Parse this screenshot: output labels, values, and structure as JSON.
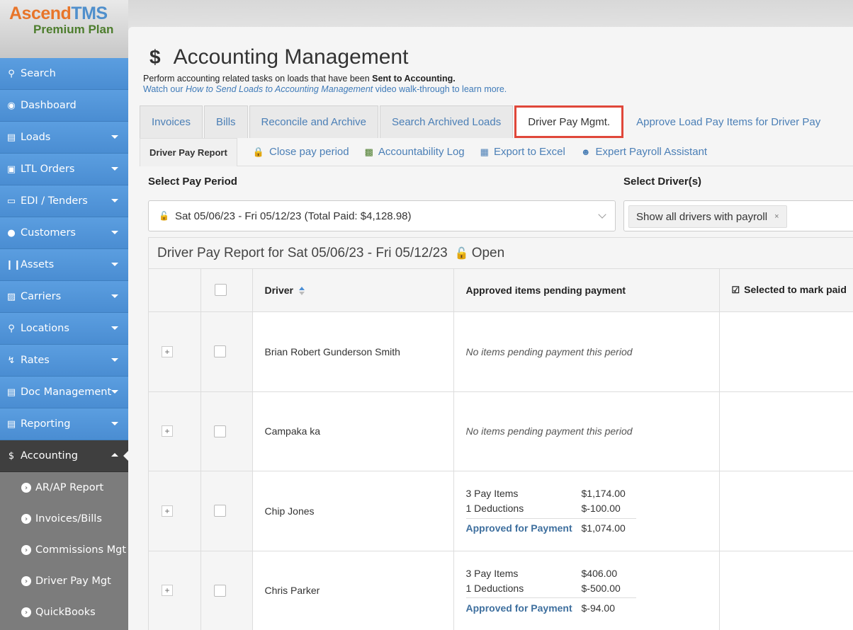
{
  "app": {
    "brand_part1": "Ascend",
    "brand_part2": "TMS",
    "plan": "Premium Plan"
  },
  "sidebar": {
    "items": [
      {
        "label": "Search",
        "icon": "search-icon",
        "caret": false
      },
      {
        "label": "Dashboard",
        "icon": "dashboard-icon",
        "caret": false
      },
      {
        "label": "Loads",
        "icon": "list-icon",
        "caret": true
      },
      {
        "label": "LTL Orders",
        "icon": "cubes-icon",
        "caret": true
      },
      {
        "label": "EDI / Tenders",
        "icon": "inbox-icon",
        "caret": true
      },
      {
        "label": "Customers",
        "icon": "users-icon",
        "caret": true
      },
      {
        "label": "Assets",
        "icon": "barcode-icon",
        "caret": true
      },
      {
        "label": "Carriers",
        "icon": "truck-icon",
        "caret": true
      },
      {
        "label": "Locations",
        "icon": "map-marker-icon",
        "caret": true
      },
      {
        "label": "Rates",
        "icon": "bolt-icon",
        "caret": true
      },
      {
        "label": "Doc Management",
        "icon": "file-icon",
        "caret": true
      },
      {
        "label": "Reporting",
        "icon": "file-text-icon",
        "caret": true
      },
      {
        "label": "Accounting",
        "icon": "dollar-icon",
        "caret": true,
        "active": true
      }
    ],
    "subitems": [
      "AR/AP Report",
      "Invoices/Bills",
      "Commissions Mgt",
      "Driver Pay Mgt",
      "QuickBooks"
    ]
  },
  "page": {
    "title": "Accounting Management",
    "subtitle_prefix": "Perform accounting related tasks on loads that have been ",
    "subtitle_bold": "Sent to Accounting.",
    "help_prefix": "Watch our ",
    "help_italic": "How to Send Loads to Accounting Management",
    "help_suffix": " video walk-through to learn more."
  },
  "tabs": [
    "Invoices",
    "Bills",
    "Reconcile and Archive",
    "Search Archived Loads",
    "Driver Pay Mgmt.",
    "Approve Load Pay Items for Driver Pay"
  ],
  "toolbar": {
    "report_tab": "Driver Pay Report",
    "close_period": "Close pay period",
    "accountability_log": "Accountability Log",
    "export_excel": "Export to Excel",
    "payroll_assistant": "Expert Payroll Assistant"
  },
  "filters": {
    "pay_period_label": "Select Pay Period",
    "pay_period_value": "Sat 05/06/23 - Fri 05/12/23 (Total Paid: $4,128.98)",
    "drivers_label": "Select Driver(s)",
    "drivers_tag": "Show all drivers with payroll"
  },
  "report": {
    "title": "Driver Pay Report for Sat 05/06/23 - Fri 05/12/23",
    "status": "Open",
    "columns": {
      "driver": "Driver",
      "pending": "Approved items pending payment",
      "selected": "Selected to mark paid"
    },
    "rows": [
      {
        "driver": "Brian Robert Gunderson Smith",
        "empty": "No items pending payment this period"
      },
      {
        "driver": "Campaka ka",
        "empty": "No items pending payment this period"
      },
      {
        "driver": "Chip Jones",
        "pay_items": "3 Pay Items",
        "pay_items_amt": "$1,174.00",
        "deductions": "1 Deductions",
        "deductions_amt": "$-100.00",
        "approved_label": "Approved for Payment",
        "approved_amt": "$1,074.00"
      },
      {
        "driver": "Chris Parker",
        "pay_items": "3 Pay Items",
        "pay_items_amt": "$406.00",
        "deductions": "1 Deductions",
        "deductions_amt": "$-500.00",
        "approved_label": "Approved for Payment",
        "approved_amt": "$-94.00"
      }
    ]
  }
}
